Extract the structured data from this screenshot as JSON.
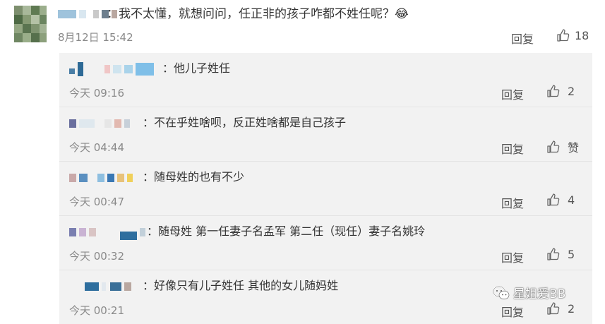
{
  "main": {
    "text": "：我不太懂，就想问问，任正非的孩子咋都不姓任呢？😂",
    "time": "8月12日 15:42",
    "reply_label": "回复",
    "likes": "18"
  },
  "replies": [
    {
      "text": "：他儿子姓任",
      "time": "今天 09:16",
      "reply_label": "回复",
      "likes": "2"
    },
    {
      "text": "：不在乎姓啥呗，反正姓啥都是自己孩子",
      "time": "今天 04:44",
      "reply_label": "回复",
      "likes": "赞"
    },
    {
      "text": "：随母姓的也有不少",
      "time": "今天 00:47",
      "reply_label": "回复",
      "likes": "4"
    },
    {
      "text": "：随母姓  第一任妻子名孟军 第二任（现任）妻子名姚玲",
      "time": "今天 00:32",
      "reply_label": "回复",
      "likes": "5"
    },
    {
      "text": "：好像只有儿子姓任 其他的女儿随妈姓",
      "time": "今天 00:21",
      "reply_label": "回复",
      "likes": "2"
    }
  ],
  "watermark": {
    "text": "星姐爱BB"
  },
  "icons": {
    "like": "thumbs-up-icon",
    "watermark": "wechat-icon"
  },
  "colors": {
    "panel_bg": "#f2f2f2",
    "time": "#8a8a8a",
    "text": "#333333"
  }
}
